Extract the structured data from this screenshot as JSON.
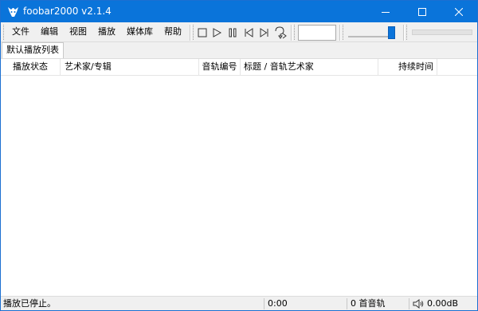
{
  "window": {
    "title": "foobar2000 v2.1.4"
  },
  "menu": {
    "items": [
      {
        "label": "文件"
      },
      {
        "label": "编辑"
      },
      {
        "label": "视图"
      },
      {
        "label": "播放"
      },
      {
        "label": "媒体库"
      },
      {
        "label": "帮助"
      }
    ]
  },
  "toolbar": {
    "buttons": [
      "stop-icon",
      "play-icon",
      "pause-icon",
      "previous-icon",
      "next-icon",
      "random-icon"
    ],
    "volume_level": 0.85,
    "seek_position": 0
  },
  "tabs": [
    {
      "label": "默认播放列表",
      "active": true
    }
  ],
  "playlist": {
    "columns": [
      "播放状态",
      "艺术家/专辑",
      "音轨编号",
      "标题 / 音轨艺术家",
      "持续时间",
      ""
    ],
    "rows": []
  },
  "status": {
    "message": "播放已停止。",
    "time": "0:00",
    "tracks": "0 首音轨",
    "volume": "0.00dB"
  },
  "colors": {
    "accent": "#0a74da",
    "titlebar": "#0a74da",
    "background": "#ffffff",
    "chrome": "#f0f0f0"
  }
}
